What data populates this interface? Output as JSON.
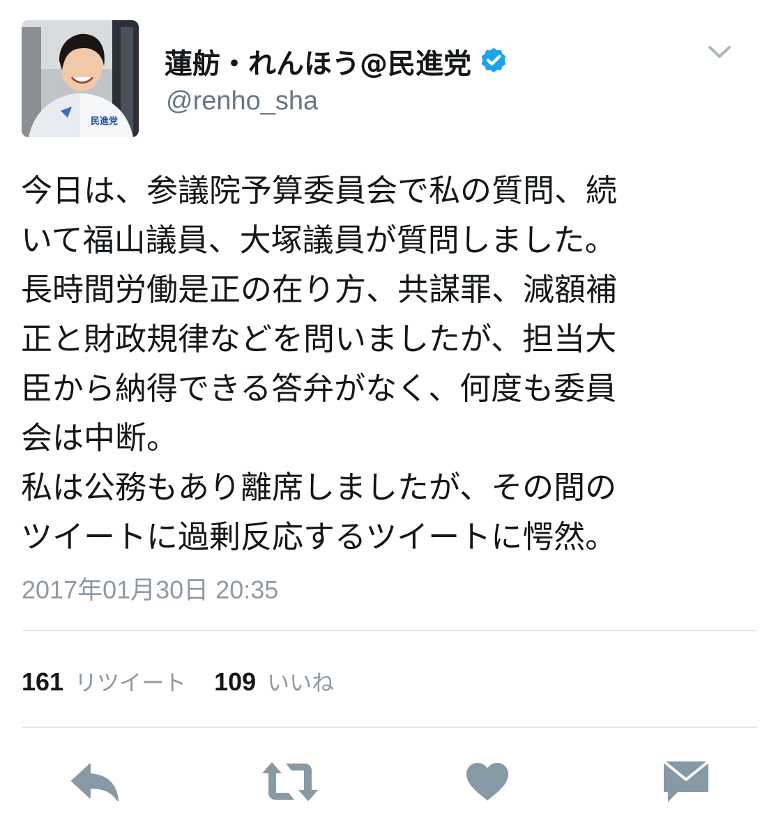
{
  "user": {
    "display_name": "蓮舫・れんほう@民進党",
    "handle": "@renho_sha",
    "verified": true,
    "avatar_icon": "profile-photo",
    "avatar_badge_text": "民進党"
  },
  "tweet": {
    "lines": [
      "今日は、参議院予算委員会で私の質問、続",
      "いて福山議員、大塚議員が質問しました。",
      "長時間労働是正の在り方、共謀罪、減額補",
      "正と財政規律などを問いましたが、担当大",
      "臣から納得できる答弁がなく、何度も委員",
      "会は中断。",
      "私は公務もあり離席しましたが、その間の",
      "ツイートに過剰反応するツイートに愕然。"
    ],
    "timestamp": "2017年01月30日 20:35"
  },
  "stats": {
    "retweets_count": "161",
    "retweets_label": "リツイート",
    "likes_count": "109",
    "likes_label": "いいね"
  },
  "actions": {
    "reply_icon": "reply-icon",
    "retweet_icon": "retweet-icon",
    "like_icon": "heart-icon",
    "dm_icon": "envelope-icon",
    "menu_icon": "chevron-down-icon"
  },
  "colors": {
    "text": "#14171a",
    "secondary": "#657786",
    "timestamp": "#8f99a3",
    "verified": "#1da1f2",
    "action_icon": "#8899a6",
    "divider": "#e3e7eb"
  }
}
